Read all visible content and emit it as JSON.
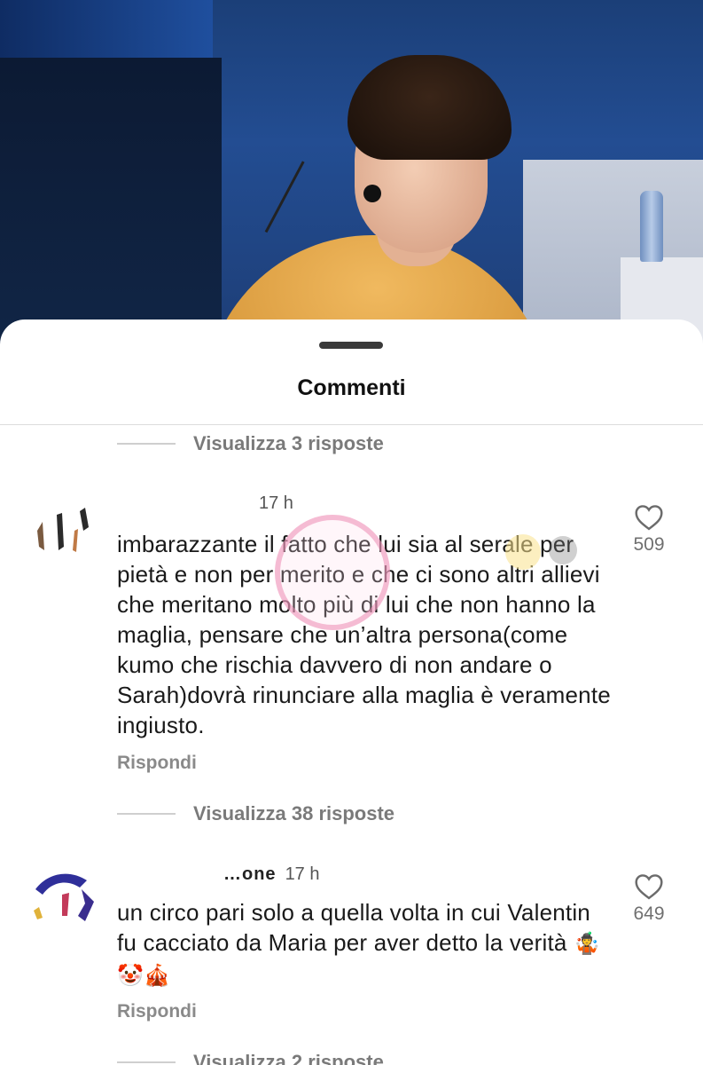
{
  "sheet": {
    "title": "Commenti"
  },
  "threads": [
    {
      "view_replies": "Visualizza 3 risposte"
    },
    {
      "view_replies": "Visualizza 38 risposte"
    },
    {
      "view_replies": "Visualizza 2 risposte"
    }
  ],
  "comments": [
    {
      "username": "",
      "time": "17 h",
      "text": "imbarazzante il fatto che lui sia al serale per pietà e non per merito e che ci sono altri allievi che meritano molto più di lui che non hanno la maglia, pensare che un’altra persona(come kumo che rischia davvero di non andare o Sarah)dovrà rinunciare alla maglia è veramente ingiusto.",
      "reply_label": "Rispondi",
      "likes": "509",
      "like_icon": "heart-outline-icon"
    },
    {
      "username": "…one",
      "time": "17 h",
      "text": "un circo pari solo a quella volta in cui Valentin fu cacciato da Maria per aver detto la verità",
      "emojis": "🤹🤡🎪",
      "reply_label": "Rispondi",
      "likes": "649",
      "like_icon": "heart-outline-icon"
    }
  ]
}
